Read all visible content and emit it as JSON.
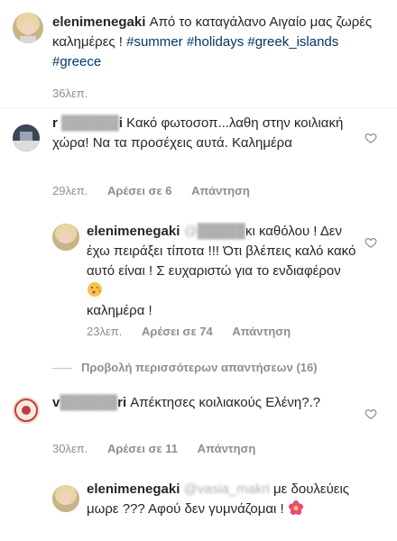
{
  "post": {
    "username": "elenimenegaki",
    "caption": "Από το καταγάλανο Αιγαίο μας ζωρές καλημέρες ! ",
    "hashtags": [
      "#summer",
      "#holidays",
      "#greek_islands",
      "#greece"
    ],
    "time": "36λεπ."
  },
  "comments": [
    {
      "username": "r",
      "username_hidden": "i",
      "text": "Κακό φωτοσοπ...λαθη στην κοιλιακή χώρα! Να τα προσέχεις αυτά. Καλημέρα",
      "time": "29λεπ.",
      "likes": "Αρέσει σε 6",
      "reply": "Απάντηση"
    },
    {
      "username": "elenimenegaki",
      "mention_hidden": "@",
      "text_after_mention": "κι καθόλου ! Δεν έχω πειράξει τίποτα !!! Ότι βλέπεις καλό κακό αυτό είναι ! Σ ευχαριστώ για το ενδιαφέρον",
      "text_end": "καλημέρα !",
      "time": "23λεπ.",
      "likes": "Αρέσει σε 74",
      "reply": "Απάντηση"
    }
  ],
  "view_more": "Προβολή περισσότερων απαντήσεων (16)",
  "comment3": {
    "username_start": "v",
    "username_end": "ri",
    "text": "Απέκτησες κοιλιακούς Ελένη?.?",
    "time": "30λεπ.",
    "likes": "Αρέσει σε 11",
    "reply": "Απάντηση"
  },
  "reply2": {
    "username": "elenimenegaki",
    "mention": "@vasia_makri",
    "text": "με δουλεύεις μωρε ??? Αφού δεν γυμνάζομαι !"
  },
  "colors": {
    "text": "#262626",
    "meta": "#8e8e8e",
    "hashtag": "#003569"
  }
}
